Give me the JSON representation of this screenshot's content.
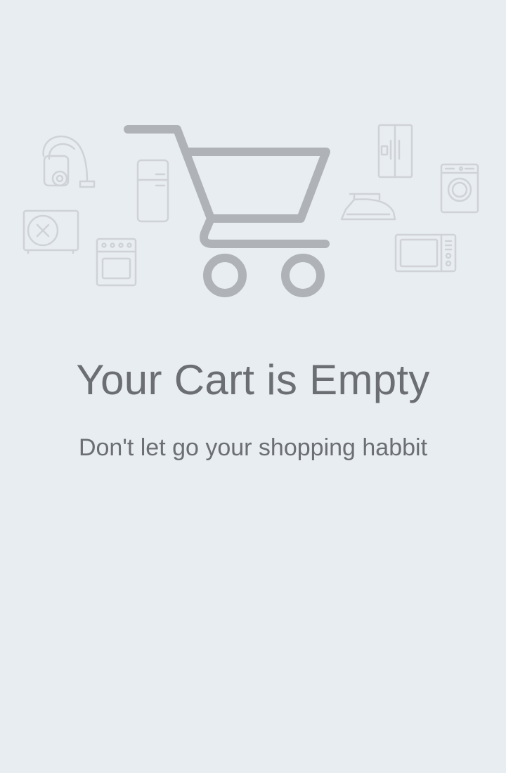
{
  "empty_state": {
    "title": "Your Cart is Empty",
    "subtitle": "Don't let go your shopping habbit"
  },
  "illustration": {
    "main_icon": "shopping-cart-icon",
    "background_icons": [
      "vacuum-cleaner-icon",
      "refrigerator-icon",
      "air-conditioner-icon",
      "oven-icon",
      "double-door-fridge-icon",
      "iron-icon",
      "washing-machine-icon",
      "microwave-icon"
    ]
  },
  "colors": {
    "background": "#e8edf1",
    "cart_stroke": "#afb3b7",
    "appliance_stroke": "#cfd3d7",
    "text": "#6b6e72"
  }
}
